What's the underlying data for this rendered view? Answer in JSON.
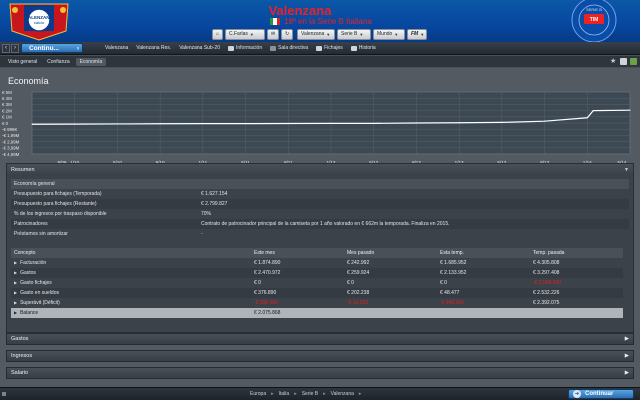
{
  "header": {
    "club_name": "Valenzana",
    "club_subtitle": "18º en la Serie B Italiana",
    "crest_text": "VALENZANA calcio",
    "league_logo_text": "SERIE B TIM",
    "controls": {
      "manager": "C.Farlas",
      "team": "Valenzana",
      "league": "Serie B",
      "world": "Mundo",
      "fm": "FM"
    },
    "colors": {
      "brand_blue": "#0747a0",
      "title_red": "#e8222a"
    }
  },
  "nav": {
    "continue_label": "Continu...",
    "links": [
      "Valenzana",
      "Valenzana Res.",
      "Valenzana Sub-20",
      "Información",
      "Sala directiva",
      "Fichajes",
      "Historia"
    ]
  },
  "subnav": {
    "tabs": [
      "Visto general",
      "Confianza",
      "Economía"
    ],
    "active": "Economía"
  },
  "page": {
    "title": "Economía"
  },
  "chart_data": {
    "type": "line",
    "title": "",
    "y_tick_labels": [
      "€ 5M",
      "€ 4M",
      "€ 3M",
      "€ 2M",
      "€ 1M",
      "€ 0",
      "-€ 999K",
      "-€ 1,99M",
      "-€ 2,99M",
      "-€ 3,99M",
      "-€ 4,99M"
    ],
    "x_tick_labels": [
      "9/09",
      "1/10",
      "5/10",
      "9/10",
      "1/11",
      "5/11",
      "9/11",
      "1/12",
      "5/12",
      "9/12",
      "1/13",
      "5/13",
      "9/13",
      "1/14",
      "5/14"
    ],
    "ylim": [
      -4.99,
      5.0
    ],
    "y_unit": "€M",
    "x": [
      "9/09",
      "1/10",
      "5/10",
      "9/10",
      "1/11",
      "5/11",
      "9/11",
      "1/12",
      "5/12",
      "9/12",
      "1/13",
      "5/13",
      "9/13",
      "1/14",
      "1/14",
      "5/14"
    ],
    "values": [
      -0.2,
      -0.18,
      -0.15,
      -0.12,
      -0.1,
      -0.1,
      -0.08,
      -0.05,
      -0.05,
      0.0,
      0.05,
      0.1,
      0.3,
      0.85,
      2.0,
      2.07
    ],
    "grid": true,
    "colors": {
      "line": "#ffffff",
      "grid": "#5d6b76",
      "background": "#3c4852"
    }
  },
  "resumen": {
    "title": "Resumen",
    "general_header": "Economía general",
    "general_rows": [
      {
        "label": "Presupuesto para fichajes (Temporada)",
        "value": "€ 1.627.154"
      },
      {
        "label": "Presupuesto para fichajes (Restante)",
        "value": "€ 2.799.827"
      },
      {
        "label": "% de los ingresos por traspaso disponible",
        "value": "70%"
      },
      {
        "label": "Patrocinadores",
        "value": "Contrato de patrocinador principal de la camiseta por 1 año valorado en € 662m la temporada. Finaliza en 2015."
      },
      {
        "label": "Préstamos sin amortizar",
        "value": "-"
      }
    ],
    "columns": [
      "Concepto",
      "Este mes",
      "Mes pasado",
      "Esta temp.",
      "Temp. pasada"
    ],
    "rows": [
      {
        "concept": "Facturación",
        "cells": [
          "€ 1.874.890",
          "€ 242.992",
          "€ 1.685.952",
          "€ 4.305.808"
        ],
        "neg": [
          false,
          false,
          false,
          false
        ]
      },
      {
        "concept": "Gastos",
        "cells": [
          "€ 2.470.972",
          "€ 259.924",
          "€ 2.133.952",
          "€ 3.297.408"
        ],
        "neg": [
          false,
          false,
          false,
          false
        ]
      },
      {
        "concept": "Gasto fichajes",
        "cells": [
          "€ 0",
          "€ 0",
          "€ 0",
          "-€ 2.048.000"
        ],
        "neg": [
          false,
          false,
          false,
          true
        ]
      },
      {
        "concept": "Gasto en sueldos",
        "cells": [
          "€ 376.890",
          "€ 202.238",
          "€ 48.477",
          "€ 2.532.226"
        ],
        "neg": [
          false,
          false,
          false,
          false
        ]
      },
      {
        "concept": "Superávit (Déficit)",
        "cells": [
          "-€ 596.082",
          "-€ 16.932",
          "-€ 448.000",
          "€ 2.392.075"
        ],
        "neg": [
          true,
          true,
          true,
          false
        ]
      },
      {
        "concept": "Balance",
        "cells": [
          "€ 2.075.868",
          "",
          "",
          ""
        ],
        "neg": [
          false,
          false,
          false,
          false
        ],
        "selected": true
      }
    ]
  },
  "sections": [
    "Gastos",
    "Ingresos",
    "Salario"
  ],
  "footer": {
    "crumbs": [
      "Europa",
      "Italia",
      "Serie B",
      "Valenzana"
    ],
    "continue_label": "Continuar"
  }
}
